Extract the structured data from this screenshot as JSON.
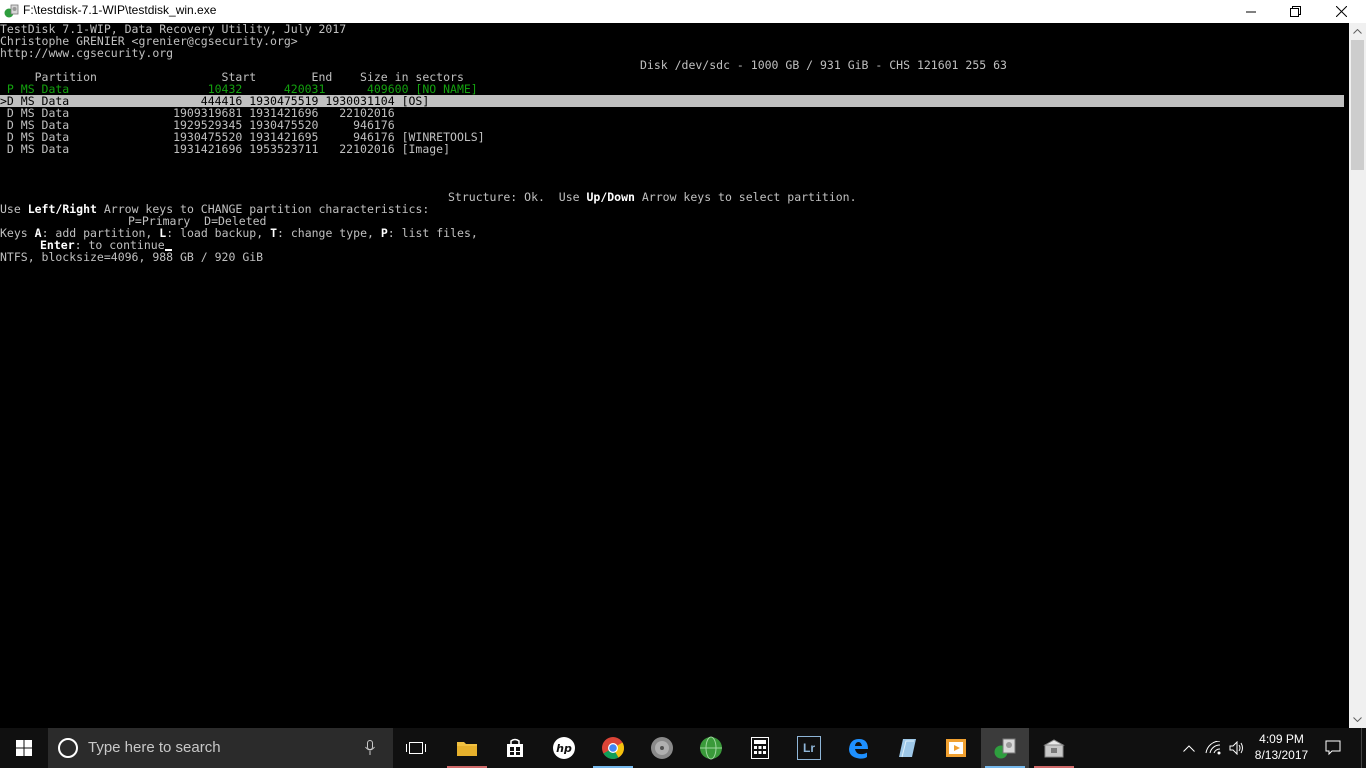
{
  "window": {
    "title": "F:\\testdisk-7.1-WIP\\testdisk_win.exe"
  },
  "console": {
    "header": [
      "TestDisk 7.1-WIP, Data Recovery Utility, July 2017",
      "Christophe GRENIER <grenier@cgsecurity.org>",
      "http://www.cgsecurity.org"
    ],
    "disk_info": "Disk /dev/sdc - 1000 GB / 931 GiB - CHS 121601 255 63",
    "columns": "     Partition                  Start        End    Size in sectors",
    "partitions": [
      {
        "text": " P MS Data                    10432      420031      409600 [NO NAME]",
        "style": "green"
      },
      {
        "text": ">D MS Data                   444416 1930475519 1930031104 [OS]",
        "style": "selected"
      },
      {
        "text": " D MS Data               1909319681 1931421696   22102016",
        "style": "normal"
      },
      {
        "text": " D MS Data               1929529345 1930475520     946176",
        "style": "normal"
      },
      {
        "text": " D MS Data               1930475520 1931421695     946176 [WINRETOOLS]",
        "style": "normal"
      },
      {
        "text": " D MS Data               1931421696 1953523711   22102016 [Image]",
        "style": "normal"
      }
    ],
    "structure": {
      "prefix": "Structure: Ok.  Use ",
      "keys": "Up/Down",
      "suffix": " Arrow keys to select partition."
    },
    "help1": {
      "prefix": "Use ",
      "keys": "Left/Right",
      "suffix": " Arrow keys to CHANGE partition characteristics:"
    },
    "legend": "P=Primary  D=Deleted",
    "help2": {
      "k1": "A",
      "t1": ": add partition, ",
      "k2": "L",
      "t2": ": load backup, ",
      "k3": "T",
      "t3": ": change type, ",
      "k4": "P",
      "t4": ": list files,",
      "prefix": "Keys "
    },
    "help3": {
      "key": "Enter",
      "suffix": ": to continue"
    },
    "fs_info": "NTFS, blocksize=4096, 988 GB / 920 GiB"
  },
  "taskbar": {
    "search_placeholder": "Type here to search",
    "time": "4:09 PM",
    "date": "8/13/2017",
    "icons": [
      "start-icon",
      "search-circle-icon",
      "microphone-icon",
      "task-view-icon",
      "file-explorer-icon",
      "store-icon",
      "hp-icon",
      "chrome-icon",
      "disk-utility-icon",
      "globe-icon",
      "calculator-icon",
      "lightroom-icon",
      "edge-icon",
      "notes-icon",
      "media-player-icon",
      "testdisk-icon",
      "installer-icon"
    ],
    "lightroom_label": "Lr"
  },
  "colors": {
    "console_bg": "#000000",
    "console_text": "#c0c0c0",
    "primary_green": "#13a10e",
    "taskbar_bg": "#101010"
  }
}
